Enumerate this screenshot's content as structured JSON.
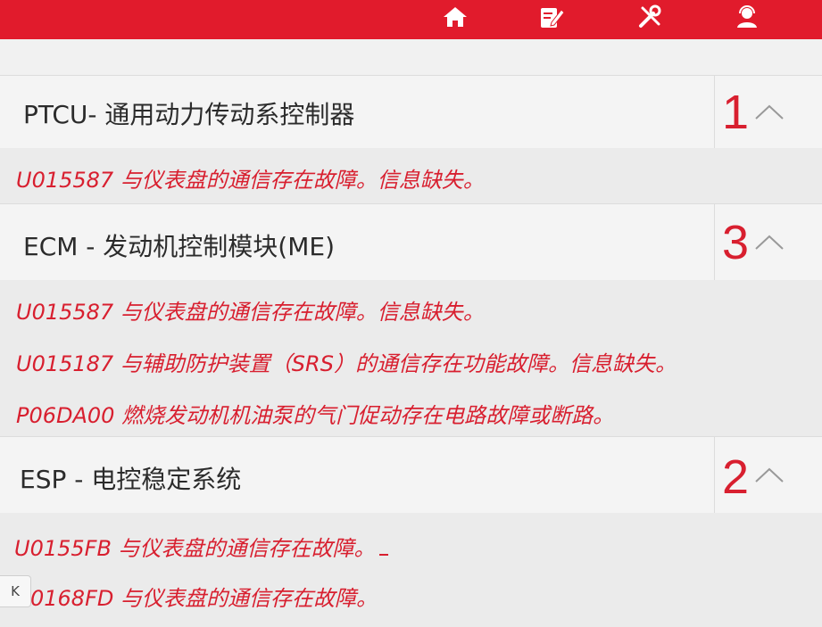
{
  "toolbar": {
    "icons": [
      "home-icon",
      "edit-report-icon",
      "tools-icon",
      "user-support-icon"
    ]
  },
  "sections": [
    {
      "title": "PTCU- 通用动力传动系控制器",
      "count": "1",
      "codes": [
        "U015587 与仪表盘的通信存在故障。信息缺失。"
      ]
    },
    {
      "title": "ECM - 发动机控制模块(ME)",
      "count": "3",
      "codes": [
        "U015587 与仪表盘的通信存在故障。信息缺失。",
        "U015187 与辅助防护装置（SRS）的通信存在功能故障。信息缺失。",
        "P06DA00 燃烧发动机机油泵的气门促动存在电路故障或断路。"
      ]
    },
    {
      "title": "ESP - 电控稳定系统",
      "count": "2",
      "codes": [
        "U0155FB 与仪表盘的通信存在故障。",
        "0168FD 与仪表盘的通信存在故障。"
      ]
    }
  ],
  "side_button": {
    "label": "K"
  },
  "colors": {
    "brand_red": "#e11b2c",
    "fault_red": "#d81f2f"
  }
}
